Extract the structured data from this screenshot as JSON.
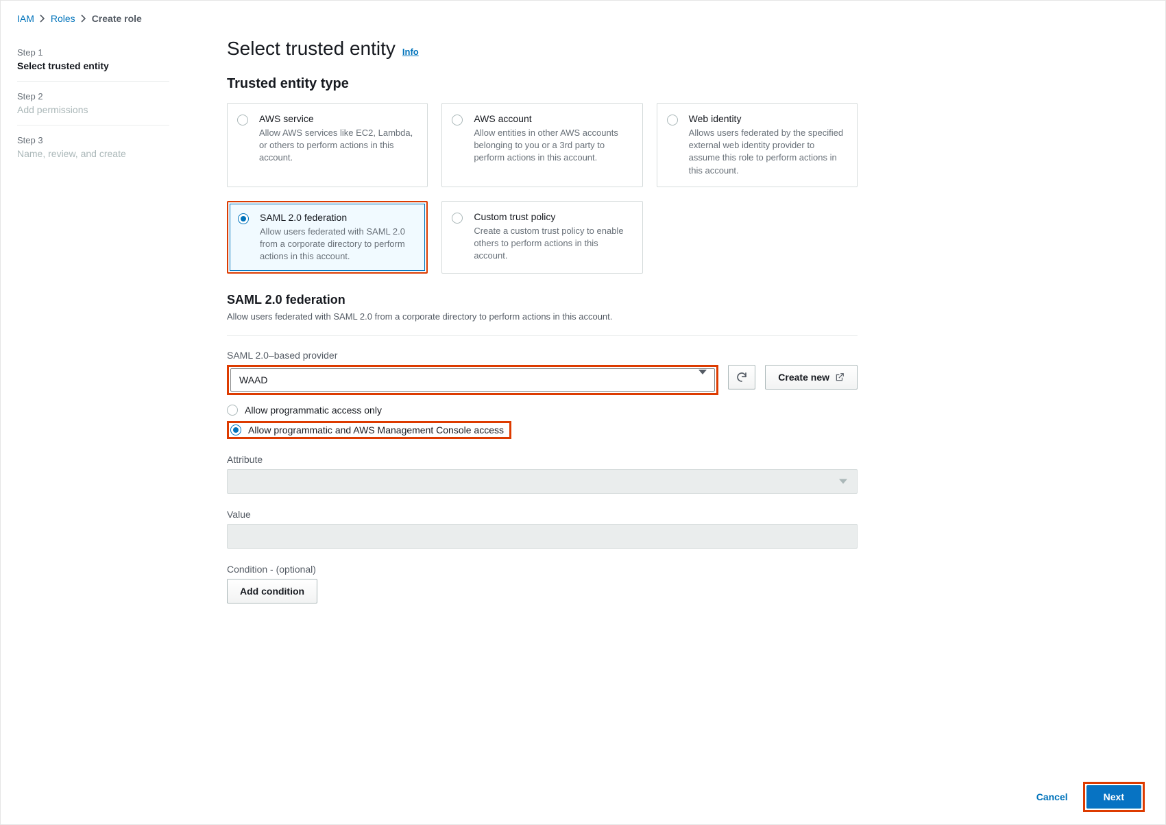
{
  "breadcrumb": {
    "iam": "IAM",
    "roles": "Roles",
    "current": "Create role"
  },
  "steps": {
    "s1num": "Step 1",
    "s1label": "Select trusted entity",
    "s2num": "Step 2",
    "s2label": "Add permissions",
    "s3num": "Step 3",
    "s3label": "Name, review, and create"
  },
  "page": {
    "title": "Select trusted entity",
    "info": "Info"
  },
  "entity_section_title": "Trusted entity type",
  "entities": [
    {
      "title": "AWS service",
      "desc": "Allow AWS services like EC2, Lambda, or others to perform actions in this account."
    },
    {
      "title": "AWS account",
      "desc": "Allow entities in other AWS accounts belonging to you or a 3rd party to perform actions in this account."
    },
    {
      "title": "Web identity",
      "desc": "Allows users federated by the specified external web identity provider to assume this role to perform actions in this account."
    },
    {
      "title": "SAML 2.0 federation",
      "desc": "Allow users federated with SAML 2.0 from a corporate directory to perform actions in this account."
    },
    {
      "title": "Custom trust policy",
      "desc": "Create a custom trust policy to enable others to perform actions in this account."
    }
  ],
  "saml_section": {
    "title": "SAML 2.0 federation",
    "desc": "Allow users federated with SAML 2.0 from a corporate directory to perform actions in this account."
  },
  "provider": {
    "label": "SAML 2.0–based provider",
    "value": "WAAD",
    "create_new": "Create new"
  },
  "access_options": {
    "opt1": "Allow programmatic access only",
    "opt2": "Allow programmatic and AWS Management Console access"
  },
  "attribute_label": "Attribute",
  "value_label": "Value",
  "condition_label": "Condition - (optional)",
  "add_condition": "Add condition",
  "footer": {
    "cancel": "Cancel",
    "next": "Next"
  }
}
